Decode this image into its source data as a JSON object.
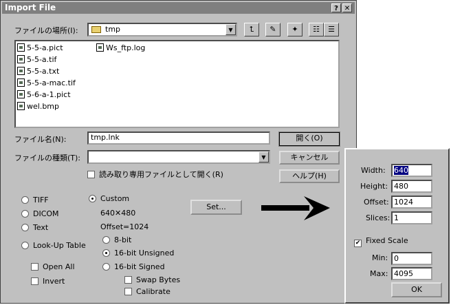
{
  "dialog": {
    "title": "Import File",
    "help_button": "?",
    "close_button": "✕",
    "look_in_label": "ファイルの場所(I):",
    "look_in_value": "tmp",
    "files": [
      {
        "name": "5-5-a.pict"
      },
      {
        "name": "5-5-a.tif"
      },
      {
        "name": "5-5-a.txt"
      },
      {
        "name": "5-5-a-mac.tif"
      },
      {
        "name": "5-6-a-1.pict"
      },
      {
        "name": "wel.bmp"
      },
      {
        "name": "Ws_ftp.log"
      }
    ],
    "filename_label": "ファイル名(N):",
    "filename_value": "tmp.lnk",
    "filetype_label": "ファイルの種類(T):",
    "filetype_value": "",
    "readonly_label": "読み取り専用ファイルとして開く(R)",
    "open_button": "開く(O)",
    "cancel_button": "キャンセル",
    "help_btn_label": "ヘルプ(H)",
    "formats": {
      "tiff": "TIFF",
      "dicom": "DICOM",
      "text": "Text",
      "lookup": "Look-Up Table",
      "custom": "Custom",
      "selected": "Custom"
    },
    "open_all": "Open All",
    "invert": "Invert",
    "custom_info": {
      "dims": "640✕480",
      "offset": "Offset=1024"
    },
    "bit_options": {
      "bit8": "8-bit",
      "bit16u": "16-bit Unsigned",
      "bit16s": "16-bit Signed",
      "selected": "16-bit Unsigned"
    },
    "swap_bytes": "Swap Bytes",
    "calibrate": "Calibrate",
    "set_button": "Set..."
  },
  "custom_panel": {
    "width_label": "Width:",
    "width_value": "640",
    "height_label": "Height:",
    "height_value": "480",
    "offset_label": "Offset:",
    "offset_value": "1024",
    "slices_label": "Slices:",
    "slices_value": "1",
    "fixed_scale_label": "Fixed Scale",
    "fixed_scale_checked": true,
    "min_label": "Min:",
    "min_value": "0",
    "max_label": "Max:",
    "max_value": "4095",
    "ok_button": "OK"
  }
}
